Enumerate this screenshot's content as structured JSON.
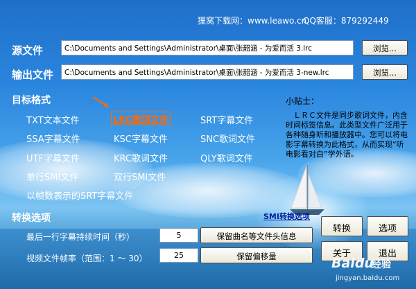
{
  "header": {
    "site": "狸窝下载网：www.leawo.cn",
    "qq": "QQ客服：879292449"
  },
  "source": {
    "label": "源文件",
    "path": "C:\\Documents and Settings\\Administrator\\桌面\\张韶涵 - 为爱而活 3.lrc",
    "browse": "浏览..."
  },
  "output": {
    "label": "输出文件",
    "path": "C:\\Documents and Settings\\Administrator\\桌面\\张韶涵 - 为爱而活 3-new.lrc",
    "browse": "浏览..."
  },
  "target": {
    "label": "目标格式",
    "formats": {
      "txt": "TXT文本文件",
      "lrc": "LRC歌词文件",
      "srt": "SRT字幕文件",
      "ssa": "SSA字幕文件",
      "ksc": "KSC字幕文件",
      "snc": "SNC歌词文件",
      "utf": "UTF字幕文件",
      "krc": "KRC歌词文件",
      "qly": "QLY歌词文件",
      "smi1": "单行SMI文件",
      "smi2": "双行SMI文件",
      "srtframe": "以帧数表示的SRT字幕文件"
    },
    "selected": "lrc"
  },
  "tips": {
    "title": "小贴士：",
    "body": "　ＬＲＣ文件是同步歌词文件，内含时间标签信息。此类型文件广泛用于各种随身听和播放器中。您可以将电影字幕转换为此格式，从而实现“听电影看对白”学外语。"
  },
  "options": {
    "label": "转换选项",
    "smi_link": "SMI转换选项",
    "last_line_label": "最后一行字幕持续时间（秒）",
    "last_line_value": "5",
    "framerate_label": "视频文件帧率（范围：1 ～ 30）",
    "framerate_value": "25",
    "keep_header": "保留曲名等文件头信息",
    "keep_offset": "保留偏移量"
  },
  "actions": {
    "convert": "转换",
    "options": "选项",
    "about": "关于",
    "exit": "退出"
  },
  "watermark": {
    "brand": "Baidu",
    "brand_cn": "经验",
    "url": "jingyan.baidu.com"
  }
}
